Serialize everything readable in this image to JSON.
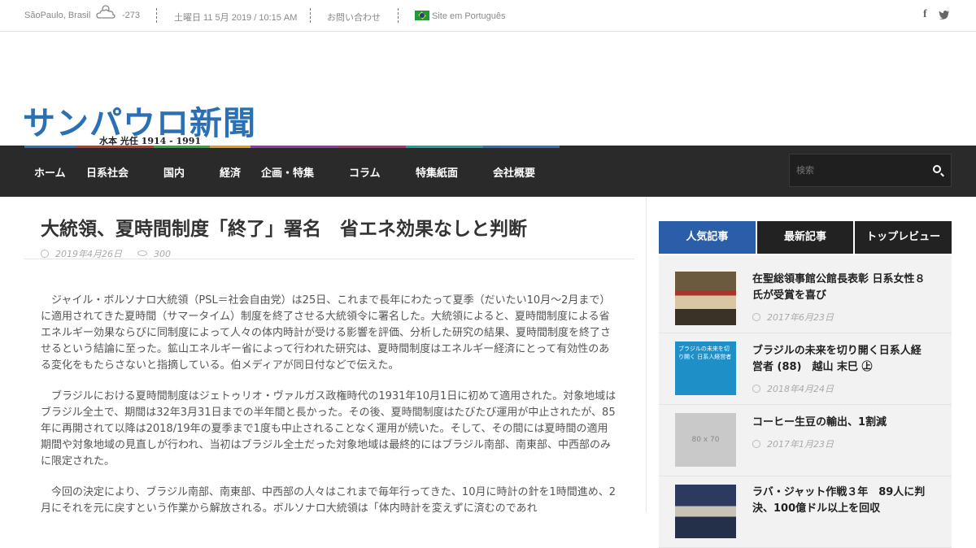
{
  "topbar": {
    "location": "SãoPaulo, Brasil",
    "temperature": "-273",
    "datetime": "土曜日 11 5月 2019 / 10:15 AM",
    "contact": "お問い合わせ",
    "language": "Site em Português"
  },
  "logo": {
    "main": "サンパウロ新聞",
    "sub": "水本 光任 1914 - 1991"
  },
  "nav": {
    "items": [
      {
        "label": "ホーム",
        "color": "#2b6fb5"
      },
      {
        "label": "日系社会",
        "color": "#c0392b"
      },
      {
        "label": "国内",
        "color": "#27ae3b"
      },
      {
        "label": "経済",
        "color": "#e39d1a"
      },
      {
        "label": "企画・特集",
        "color": "#8e3aa8"
      },
      {
        "label": "コラム",
        "color": "#b0316f"
      },
      {
        "label": "特集紙面",
        "color": "#15a7a0"
      },
      {
        "label": "会社概要",
        "color": "#2c6fbf"
      }
    ],
    "search_placeholder": "検索"
  },
  "article": {
    "title": "大統領、夏時間制度「終了」署名　省エネ効果なしと判断",
    "date": "2019年4月26日",
    "views": "300",
    "paragraphs": [
      "ジャイル・ボルソナロ大統領（PSL＝社会自由党）は25日、これまで長年にわたって夏季（だいたい10月～2月まで）に適用されてきた夏時間（サマータイム）制度を終了させる大統領令に署名した。大統領によると、夏時間制度による省エネルギー効果ならびに同制度によって人々の体内時計が受ける影響を評価、分析した研究の結果、夏時間制度を終了させるという結論に至った。鉱山エネルギー省によって行われた研究は、夏時間制度はエネルギー経済にとって有効性のある変化をもたらさないと指摘している。伯メディアが同日付などで伝えた。",
      "ブラジルにおける夏時間制度はジェトゥリオ・ヴァルガス政権時代の1931年10月1日に初めて適用された。対象地域はブラジル全土で、期間は32年3月31日までの半年間と長かった。その後、夏時間制度はたびたび運用が中止されたが、85年に再開されて以降は2018/19年の夏季まで1度も中止されることなく運用が続いた。そして、その間には夏時間の適用期間や対象地域の見直しが行われ、当初はブラジル全土だった対象地域は最終的にはブラジル南部、南東部、中西部のみに限定された。",
      "今回の決定により、ブラジル南部、南東部、中西部の人々はこれまで毎年行ってきた、10月に時計の針を1時間進め、2月にそれを元に戻すという作業から解放される。ボルソナロ大統領は「体内時計を変えずに済むのであれ"
    ]
  },
  "sidebar": {
    "tabs": [
      "人気記事",
      "最新記事",
      "トップレビュー"
    ],
    "posts": [
      {
        "title": "在聖総領事館公館長表彰 日系女性８氏が受賞を喜び",
        "date": "2017年6月23日"
      },
      {
        "title": "ブラジルの未来を切り開く日系人経営者 (88)　越山 末巳 ㊤",
        "date": "2018年4月24日",
        "thumb_text": "ブラジルの未来を切り開く 日系人経営者"
      },
      {
        "title": "コーヒー生豆の輸出、1割減",
        "date": "2017年1月23日",
        "thumb_text": "80 x 70"
      },
      {
        "title": "ラバ・ジャット作戦３年　89人に判決、100億ドル以上を回収",
        "date": ""
      }
    ]
  }
}
